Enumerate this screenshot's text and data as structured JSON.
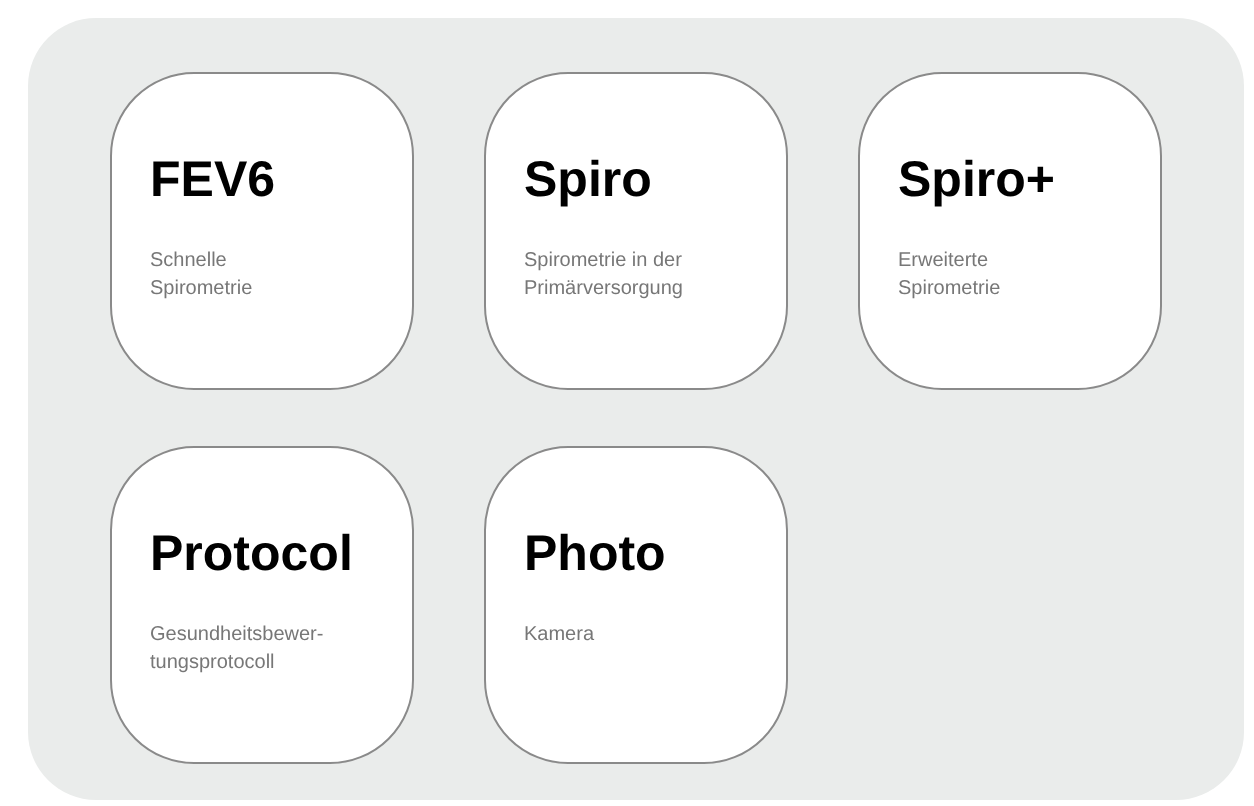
{
  "tiles": [
    {
      "title": "FEV6",
      "subtitle": "Schnelle\nSpirometrie"
    },
    {
      "title": "Spiro",
      "subtitle": "Spirometrie in der\nPrimärversorgung"
    },
    {
      "title": "Spiro+",
      "subtitle": "Erweiterte\nSpirometrie"
    },
    {
      "title": "Protocol",
      "subtitle": "Gesundheitsbewer-\ntungsprotocoll"
    },
    {
      "title": "Photo",
      "subtitle": "Kamera"
    }
  ]
}
